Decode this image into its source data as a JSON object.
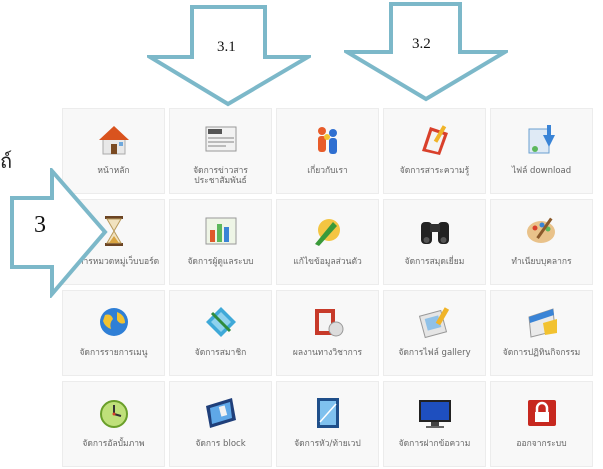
{
  "side_text": "ถ์",
  "annotations": {
    "arrow_3_1": "3.1",
    "arrow_3_2": "3.2",
    "arrow_3": "3"
  },
  "colors": {
    "arrow_stroke": "#7cb8c9",
    "tile_bg": "#f8f8f8",
    "label": "#666666"
  },
  "tiles": [
    {
      "label": "หน้าหลัก",
      "icon": "home-icon"
    },
    {
      "label": "จัดการข่าวสารประชาสัมพันธ์",
      "icon": "newspaper-icon"
    },
    {
      "label": "เกี่ยวกับเรา",
      "icon": "people-icon"
    },
    {
      "label": "จัดการสาระความรู้",
      "icon": "knowledge-icon"
    },
    {
      "label": "ไฟล์ download",
      "icon": "download-icon"
    },
    {
      "label": "จัดการหมวดหมู่เว็บบอร์ด",
      "icon": "hourglass-icon"
    },
    {
      "label": "จัดการผู้ดูแลระบบ",
      "icon": "admin-chart-icon"
    },
    {
      "label": "แก้ไขข้อมูลส่วนตัว",
      "icon": "edit-profile-icon"
    },
    {
      "label": "จัดการสมุดเยี่ยม",
      "icon": "binoculars-icon"
    },
    {
      "label": "ทำเนียบบุคลากร",
      "icon": "palette-icon"
    },
    {
      "label": "จัดการรายการเมนู",
      "icon": "globe-icon"
    },
    {
      "label": "จัดการสมาชิก",
      "icon": "members-icon"
    },
    {
      "label": "ผลงานทางวิชาการ",
      "icon": "academic-icon"
    },
    {
      "label": "จัดการไฟล์ gallery",
      "icon": "gallery-icon"
    },
    {
      "label": "จัดการปฏิทินกิจกรรม",
      "icon": "calendar-icon"
    },
    {
      "label": "จัดการอัลบั้มภาพ",
      "icon": "clock-album-icon"
    },
    {
      "label": "จัดการ block",
      "icon": "block-icon"
    },
    {
      "label": "จัดการหัว/ท้ายเวป",
      "icon": "header-footer-icon"
    },
    {
      "label": "จัดการฝากข้อความ",
      "icon": "monitor-icon"
    },
    {
      "label": "ออกจากระบบ",
      "icon": "logout-lock-icon"
    }
  ]
}
